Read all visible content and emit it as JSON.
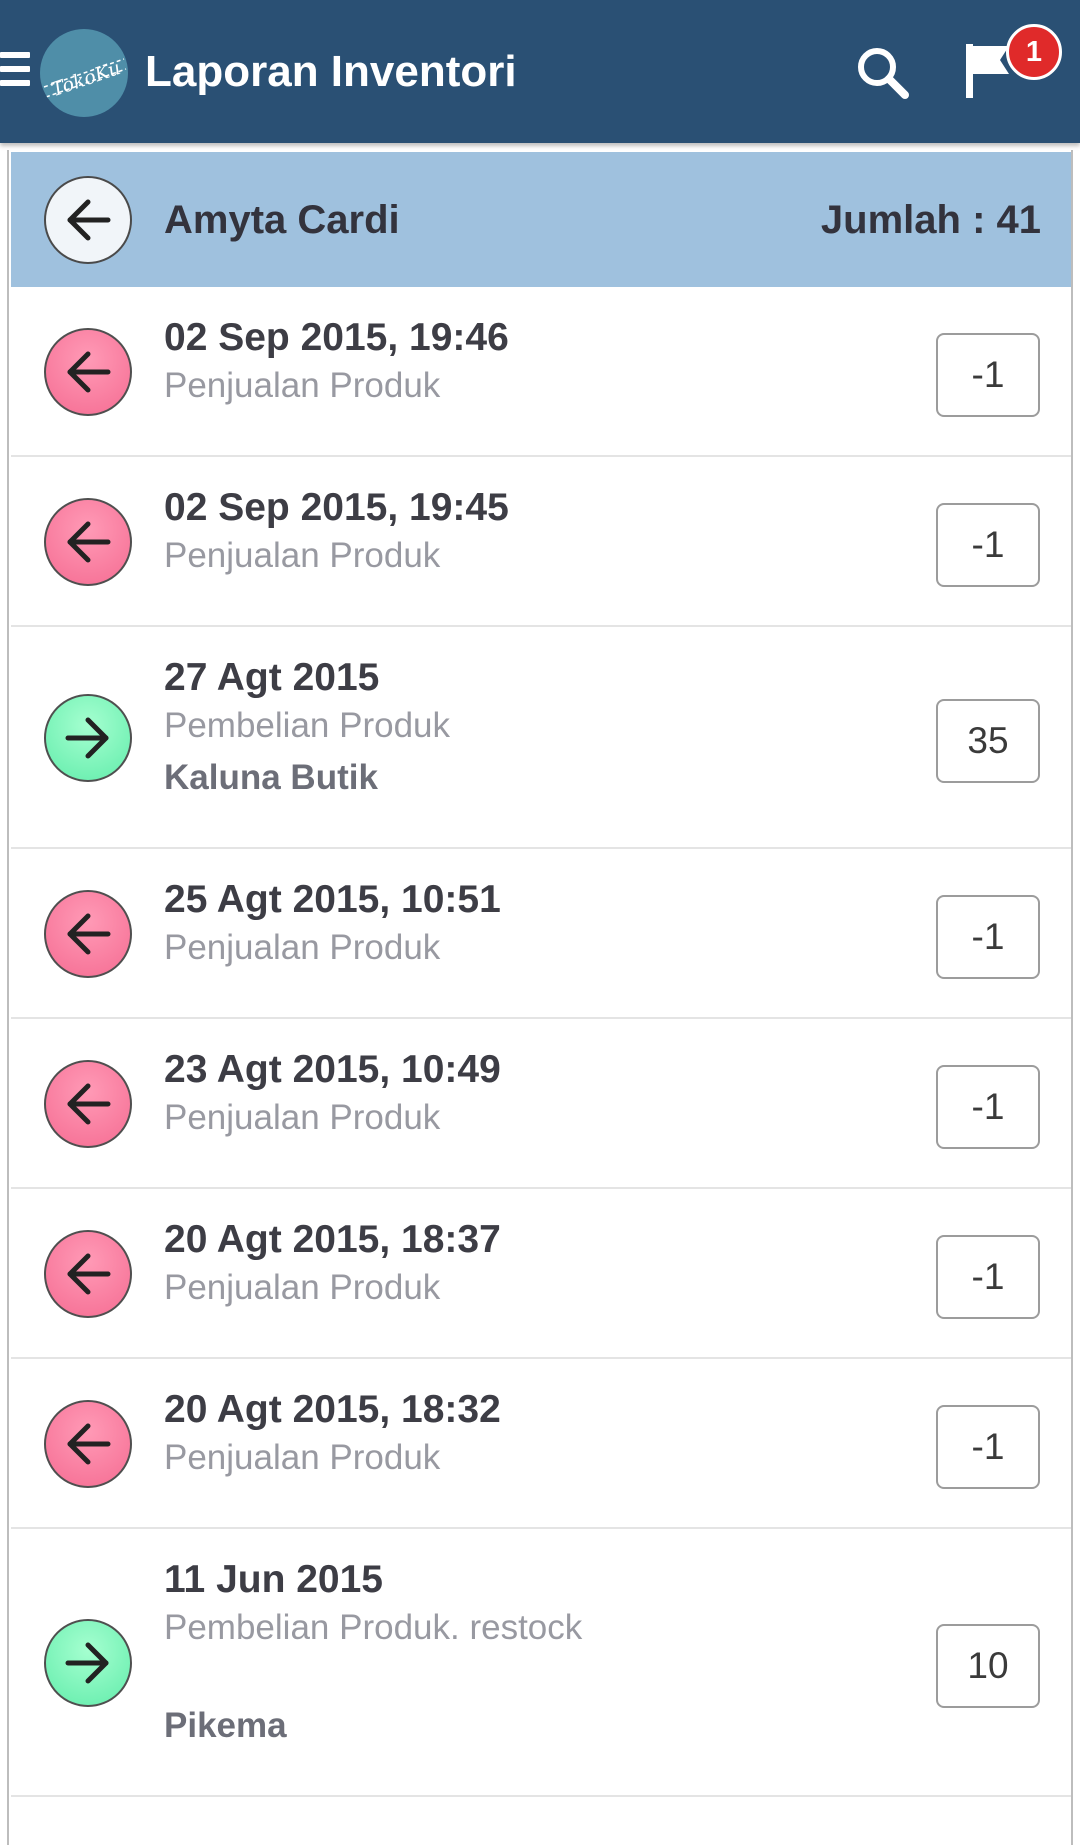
{
  "app_bar": {
    "title": "Laporan Inventori",
    "logo_text": "TokoKu",
    "notification_count": "1",
    "icons": [
      "menu-icon",
      "search-icon",
      "flag-icon"
    ],
    "background": "#2a5074"
  },
  "summary": {
    "name": "Amyta Cardi",
    "total": "Jumlah : 41",
    "background": "#9fc1de"
  },
  "colors": {
    "outgoing": "#f56c92",
    "incoming": "#62ecab"
  },
  "transactions": [
    {
      "date": "02 Sep 2015, 19:46",
      "type": "Penjualan Produk",
      "supplier": "",
      "quantity": "-1",
      "direction": "out",
      "icon": "arrow-left-icon"
    },
    {
      "date": "02 Sep 2015, 19:45",
      "type": "Penjualan Produk",
      "supplier": "",
      "quantity": "-1",
      "direction": "out",
      "icon": "arrow-left-icon"
    },
    {
      "date": "27 Agt 2015",
      "type": "Pembelian Produk",
      "supplier": "Kaluna Butik",
      "quantity": "35",
      "direction": "in",
      "icon": "arrow-right-icon"
    },
    {
      "date": "25 Agt 2015, 10:51",
      "type": "Penjualan Produk",
      "supplier": "",
      "quantity": "-1",
      "direction": "out",
      "icon": "arrow-left-icon"
    },
    {
      "date": "23 Agt 2015, 10:49",
      "type": "Penjualan Produk",
      "supplier": "",
      "quantity": "-1",
      "direction": "out",
      "icon": "arrow-left-icon"
    },
    {
      "date": "20 Agt 2015, 18:37",
      "type": "Penjualan Produk",
      "supplier": "",
      "quantity": "-1",
      "direction": "out",
      "icon": "arrow-left-icon"
    },
    {
      "date": "20 Agt 2015, 18:32",
      "type": "Penjualan Produk",
      "supplier": "",
      "quantity": "-1",
      "direction": "out",
      "icon": "arrow-left-icon"
    },
    {
      "date": "11 Jun 2015",
      "type": "Pembelian Produk. restock",
      "supplier": "Pikema",
      "quantity": "10",
      "direction": "in",
      "icon": "arrow-right-icon"
    }
  ]
}
